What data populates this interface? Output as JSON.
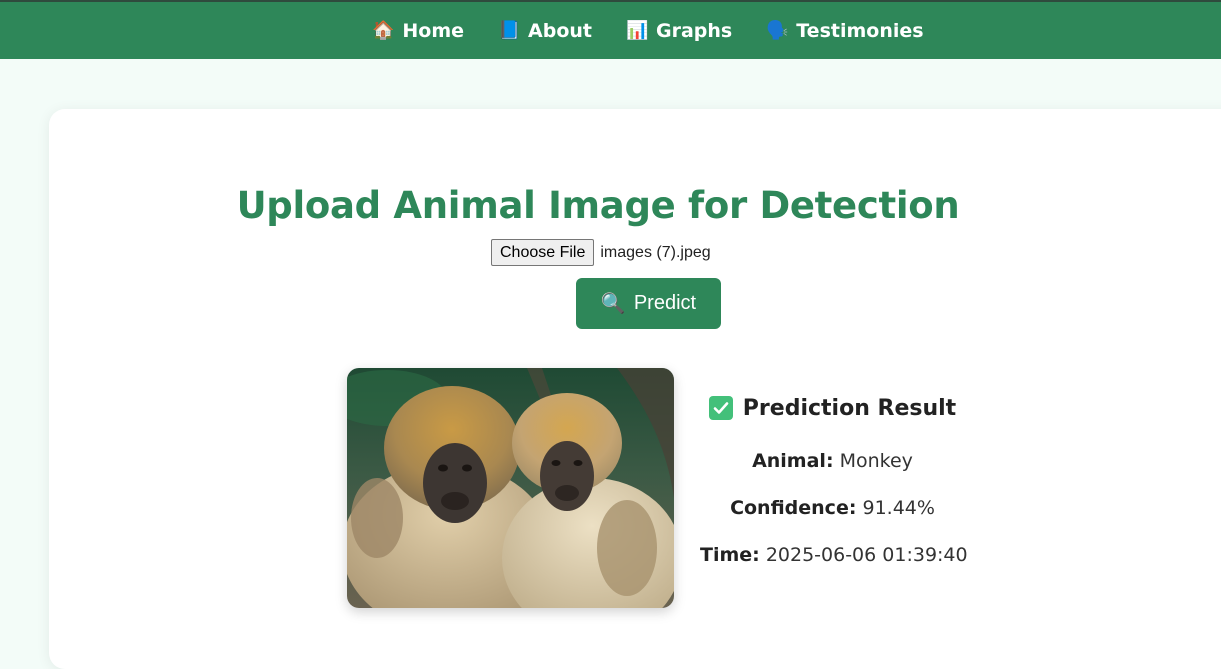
{
  "nav": {
    "items": [
      {
        "emoji": "🏠",
        "label": "Home"
      },
      {
        "emoji": "📘",
        "label": "About"
      },
      {
        "emoji": "📊",
        "label": "Graphs"
      },
      {
        "emoji": "🗣️",
        "label": "Testimonies"
      }
    ]
  },
  "upload": {
    "title": "Upload Animal Image for Detection",
    "choose_file_label": "Choose File",
    "file_name": "images (7).jpeg",
    "predict_emoji": "🔍",
    "predict_label": "Predict"
  },
  "result": {
    "heading": "Prediction Result",
    "animal_label": "Animal:",
    "animal_value": "Monkey",
    "confidence_label": "Confidence:",
    "confidence_value": "91.44%",
    "time_label": "Time:",
    "time_value": "2025-06-06 01:39:40"
  },
  "colors": {
    "primary": "#2e8759",
    "page_background": "#f3fcf8",
    "card_background": "#ffffff"
  },
  "icons": {
    "nav": [
      "home-icon",
      "book-icon",
      "bar-chart-icon",
      "speaking-head-icon"
    ],
    "predict": "magnifier-icon",
    "result": "check-mark-icon"
  }
}
